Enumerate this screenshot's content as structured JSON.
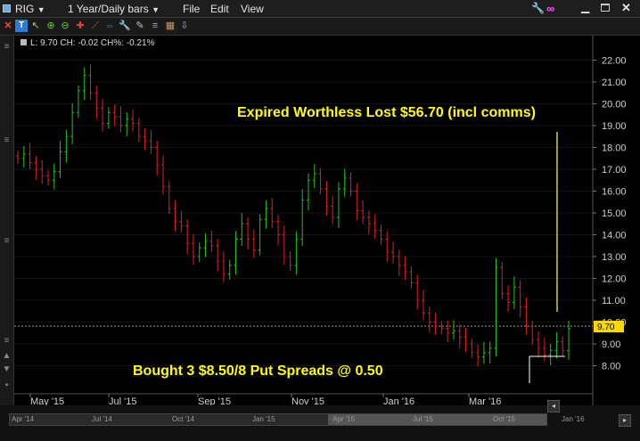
{
  "header": {
    "symbol": "RIG",
    "timeframe": "1 Year/Daily bars",
    "menu": [
      "File",
      "Edit",
      "View"
    ]
  },
  "info_line": "L: 9.70 CH: -0.02 CH%: -0.21%",
  "price_tag": "9.70",
  "icons": {
    "window": [
      "wrench-icon",
      "link-icon",
      "minimize-icon",
      "maximize-icon",
      "close-icon"
    ],
    "toolbar": [
      "close-x-icon",
      "zoom-in-icon",
      "zoom-out-icon",
      "crosshair-icon",
      "trendline-icon",
      "settings-icon",
      "grid-icon"
    ]
  },
  "annotations": {
    "top": "Expired Worthless Lost $56.70 (incl comms)",
    "bottom": "Bought 3 $8.50/8 Put Spreads @ 0.50"
  },
  "colors": {
    "up": "#1fc31f",
    "down": "#e02020",
    "annotation": "#ffff00",
    "price_tag_bg": "#ffd700",
    "axis_text": "#d0d0d0"
  },
  "chart_data": {
    "type": "candlestick",
    "x_ticks": [
      "May '15",
      "Jul '15",
      "Sep '15",
      "Nov '15",
      "Jan '16",
      "Mar '16"
    ],
    "y_ticks": [
      "22.00",
      "21.00",
      "20.00",
      "19.00",
      "18.00",
      "17.00",
      "16.00",
      "15.00",
      "14.00",
      "13.00",
      "12.00",
      "11.00",
      "10.00",
      "9.00",
      "8.00"
    ],
    "ylim": [
      7,
      22.5
    ],
    "closes": [
      17.5,
      17.7,
      17.3,
      17.0,
      16.7,
      16.5,
      16.9,
      17.8,
      18.5,
      19.6,
      20.6,
      21.3,
      20.5,
      19.8,
      19.1,
      19.6,
      19.4,
      19.0,
      19.3,
      19.1,
      18.5,
      18.3,
      18.0,
      17.2,
      16.2,
      15.2,
      14.6,
      14.4,
      13.6,
      13.0,
      13.4,
      13.7,
      13.5,
      12.8,
      12.2,
      12.6,
      13.8,
      14.5,
      13.8,
      13.3,
      14.7,
      15.2,
      14.6,
      14.0,
      13.0,
      12.6,
      13.8,
      15.6,
      16.5,
      16.8,
      16.1,
      15.3,
      14.8,
      16.1,
      16.6,
      16.0,
      15.1,
      14.8,
      14.5,
      14.2,
      13.8,
      13.2,
      13.0,
      12.6,
      12.3,
      11.8,
      11.0,
      10.4,
      10.0,
      9.8,
      9.7,
      9.5,
      9.6,
      9.3,
      9.0,
      8.6,
      8.4,
      8.6,
      8.8,
      12.5,
      11.3,
      10.9,
      11.6,
      10.7,
      9.8,
      9.2,
      8.8,
      8.5,
      8.7,
      9.1,
      8.7,
      9.7
    ],
    "bar_count": 92
  }
}
